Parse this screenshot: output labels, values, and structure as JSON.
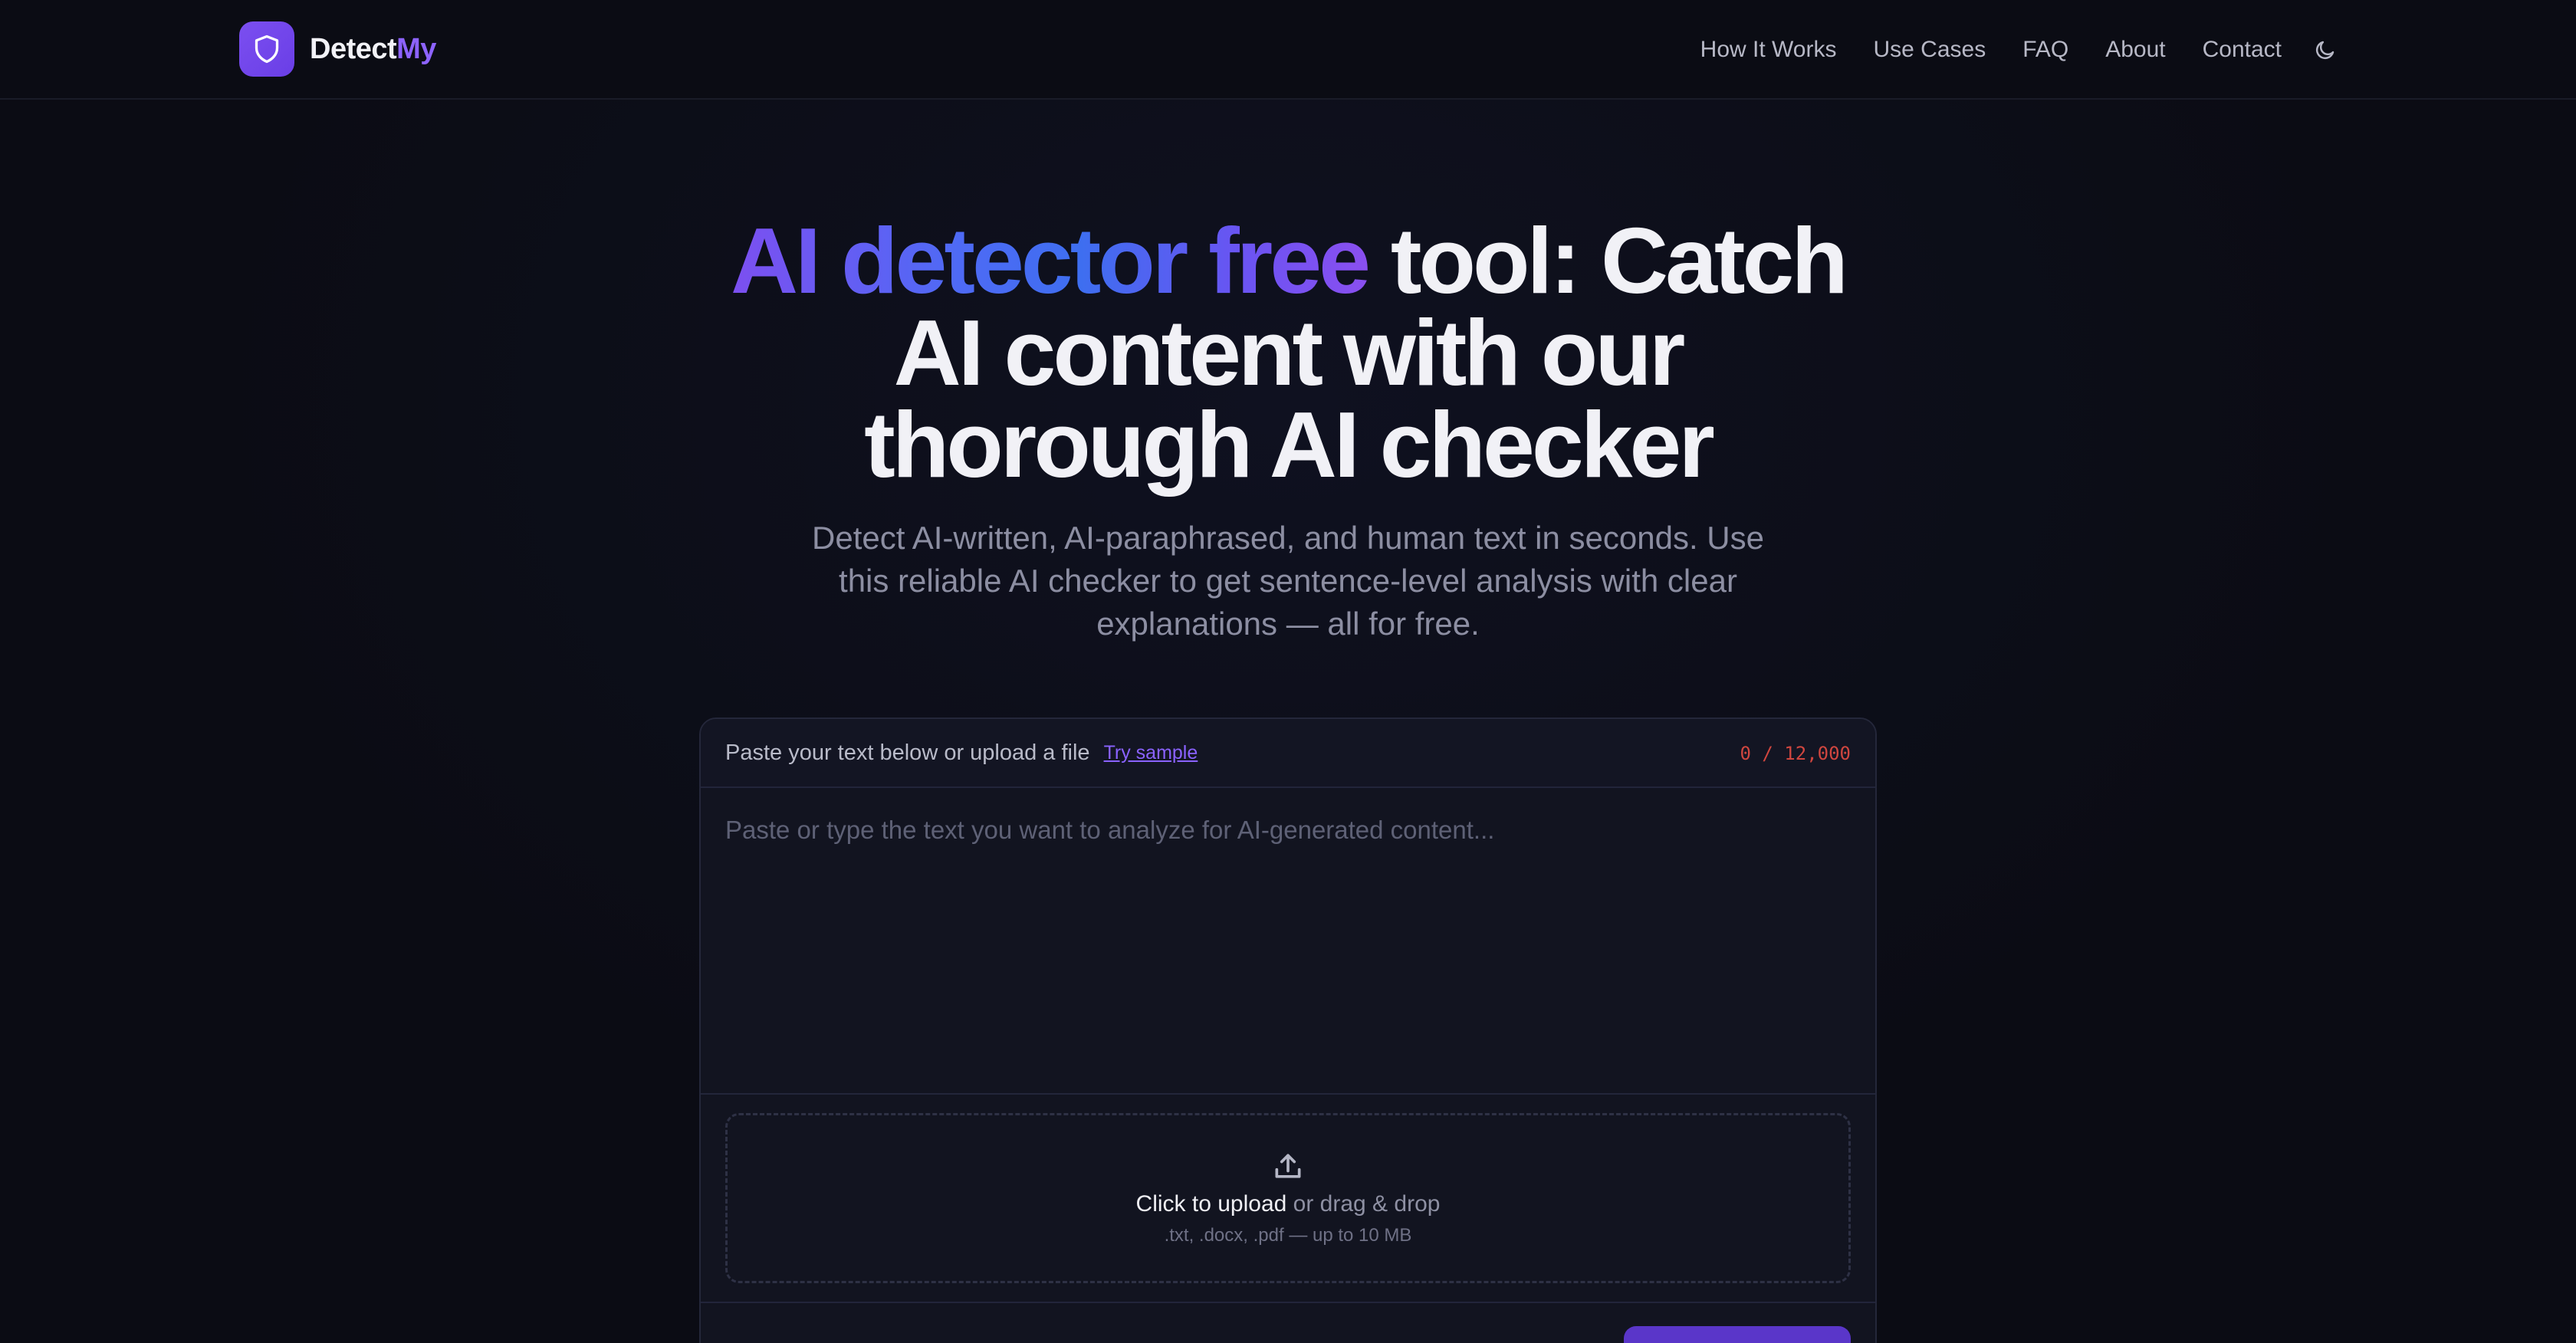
{
  "brand": {
    "name_main": "Detect",
    "name_accent": "My"
  },
  "nav": {
    "links": [
      "How It Works",
      "Use Cases",
      "FAQ",
      "About",
      "Contact"
    ],
    "theme_toggle_icon": "moon-icon"
  },
  "hero": {
    "title_highlight": "AI detector free",
    "title_rest": " tool: Catch AI content with our thorough AI checker",
    "subtitle": "Detect AI-written, AI-paraphrased, and human text in seconds. Use this reliable AI checker to get sentence-level analysis with clear explanations — all for free."
  },
  "panel": {
    "header_label": "Paste your text below or upload a file",
    "try_sample": "Try sample",
    "char_count": "0 / 12,000",
    "textarea_placeholder": "Paste or type the text you want to analyze for AI-generated content...",
    "textarea_value": "",
    "upload": {
      "icon": "upload-icon",
      "click_text": "Click to upload",
      "drag_text": " or drag & drop",
      "hint": ".txt, .docx, .pdf — up to 10 MB"
    }
  },
  "colors": {
    "accent": "#8d63ff",
    "background": "#0b0c14",
    "panel": "#121420",
    "counter": "#d0463f"
  }
}
